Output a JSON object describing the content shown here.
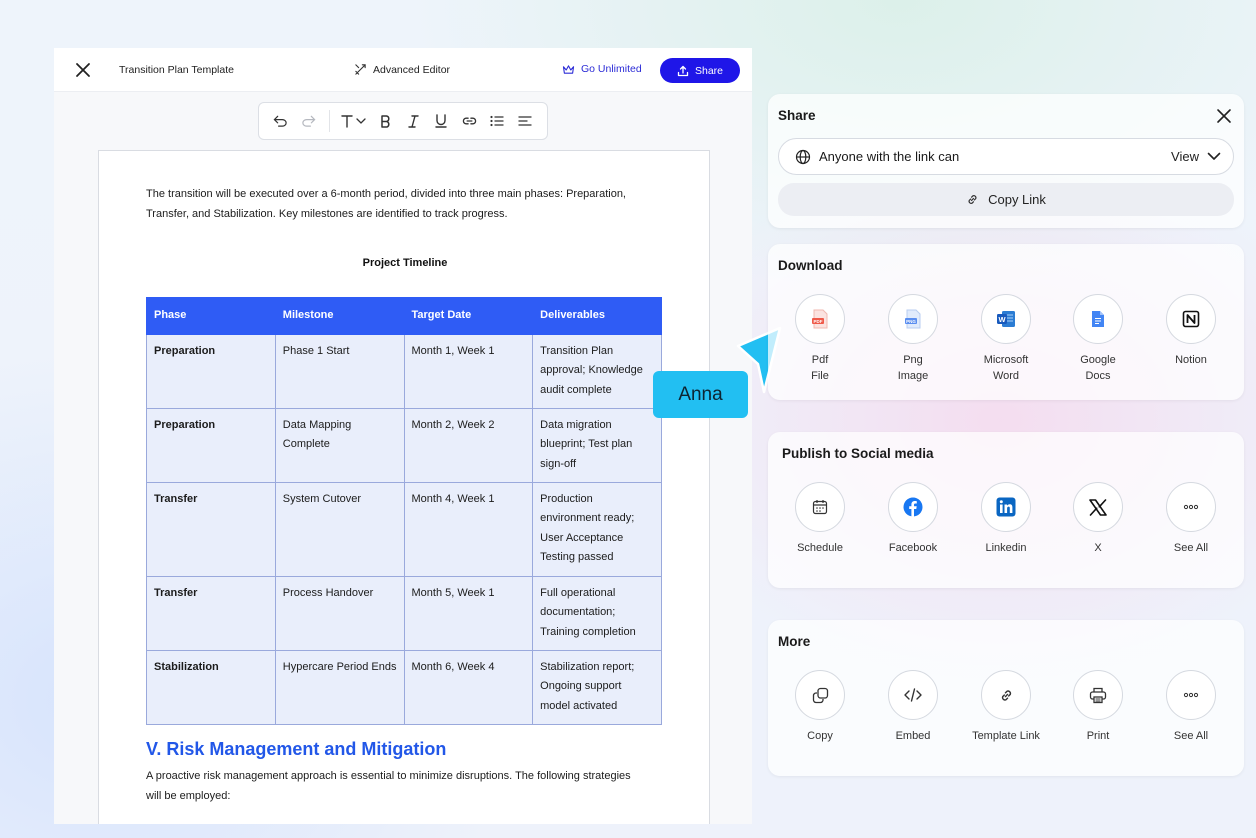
{
  "editor": {
    "doc_title": "Transition Plan Template",
    "advanced_editor": "Advanced Editor",
    "go_unlimited": "Go Unlimited",
    "share": "Share"
  },
  "document": {
    "intro": "The transition will be executed over a 6-month period, divided into three main phases: Preparation, Transfer, and Stabilization. Key milestones are identified to track progress.",
    "timeline_title": "Project Timeline",
    "headers": [
      "Phase",
      "Milestone",
      "Target Date",
      "Deliverables"
    ],
    "rows": [
      [
        "Preparation",
        "Phase 1 Start",
        "Month 1, Week 1",
        "Transition Plan approval; Knowledge audit complete"
      ],
      [
        "Preparation",
        "Data Mapping Complete",
        "Month 2, Week 2",
        "Data migration blueprint; Test plan sign-off"
      ],
      [
        "Transfer",
        "System Cutover",
        "Month 4, Week 1",
        "Production environment ready; User Acceptance Testing passed"
      ],
      [
        "Transfer",
        "Process Handover",
        "Month 5, Week 1",
        "Full operational documentation; Training completion"
      ],
      [
        "Stabilization",
        "Hypercare Period Ends",
        "Month 6, Week 4",
        "Stabilization report; Ongoing support model activated"
      ]
    ],
    "risk_heading": "V. Risk Management and Mitigation",
    "risk_para": "A proactive risk management approach is essential to minimize disruptions. The following strategies will be employed:"
  },
  "cursor_label": "Anna",
  "share_panel": {
    "title": "Share",
    "access": "Anyone with the link can",
    "permission": "View",
    "copy_link": "Copy Link"
  },
  "download": {
    "title": "Download",
    "items": [
      {
        "label": "Pdf\nFile",
        "icon": "pdf-file-icon"
      },
      {
        "label": "Png\nImage",
        "icon": "png-image-icon"
      },
      {
        "label": "Microsoft\nWord",
        "icon": "word-icon"
      },
      {
        "label": "Google\nDocs",
        "icon": "google-docs-icon"
      },
      {
        "label": "Notion",
        "icon": "notion-icon"
      }
    ]
  },
  "social": {
    "title": "Publish to Social media",
    "items": [
      {
        "label": "Schedule",
        "icon": "calendar-icon"
      },
      {
        "label": "Facebook",
        "icon": "facebook-icon"
      },
      {
        "label": "Linkedin",
        "icon": "linkedin-icon"
      },
      {
        "label": "X",
        "icon": "x-icon"
      },
      {
        "label": "See All",
        "icon": "more-dots-icon"
      }
    ]
  },
  "more": {
    "title": "More",
    "items": [
      {
        "label": "Copy",
        "icon": "copy-icon"
      },
      {
        "label": "Embed",
        "icon": "code-icon"
      },
      {
        "label": "Template Link",
        "icon": "link-icon"
      },
      {
        "label": "Print",
        "icon": "printer-icon"
      },
      {
        "label": "See All",
        "icon": "more-dots-icon"
      }
    ]
  },
  "colors": {
    "primary": "#1f16e8",
    "table_header": "#2f5cf5",
    "table_cell": "#e9eefb",
    "heading_blue": "#2257e8",
    "cursor": "#22bff2"
  }
}
